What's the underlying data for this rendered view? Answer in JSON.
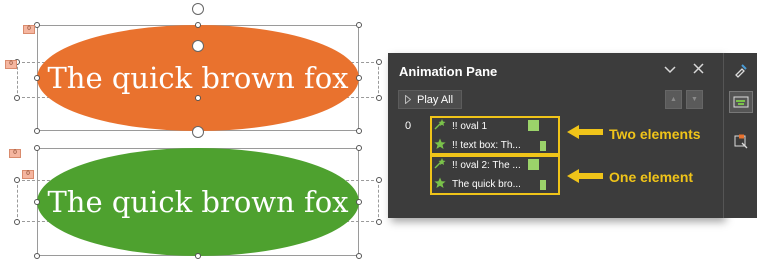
{
  "slide": {
    "shape1": {
      "text": "The quick brown fox",
      "fill": "#e9722e"
    },
    "shape2": {
      "text": "The quick brown fox",
      "fill": "#4ea12f"
    },
    "tags": [
      "0",
      "0",
      "0",
      "0"
    ]
  },
  "pane": {
    "title": "Animation Pane",
    "play_all": "Play All",
    "step_number": "0",
    "items": [
      {
        "label": "!! oval 1",
        "icon": "fly-in-effect-icon"
      },
      {
        "label": "!! text box: Th...",
        "icon": "star-effect-icon"
      },
      {
        "label": "!! oval 2: The ...",
        "icon": "fly-in-effect-icon"
      },
      {
        "label": "The quick bro...",
        "icon": "star-effect-icon"
      }
    ],
    "background": "#3c3c3c",
    "highlight": "#f0c419",
    "timing_bar": "#9bd36a"
  },
  "annotations": {
    "group1": "Two elements",
    "group2": "One element"
  }
}
